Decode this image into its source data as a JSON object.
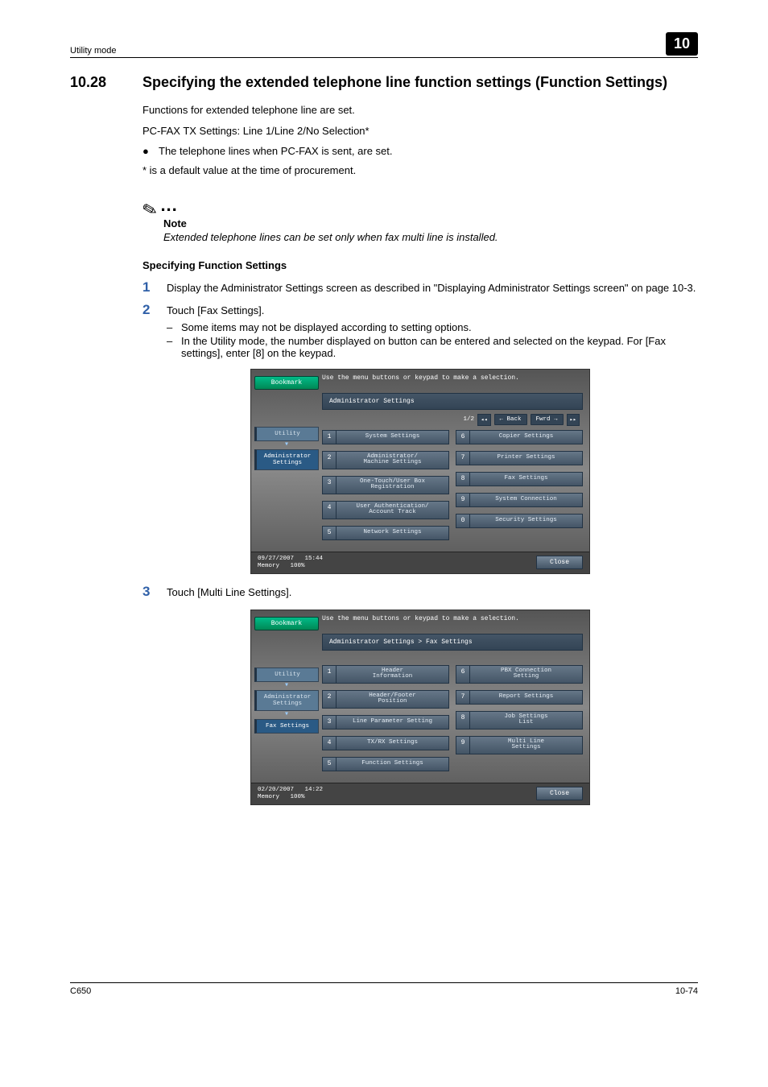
{
  "header": {
    "left": "Utility mode",
    "badge": "10"
  },
  "section": {
    "number": "10.28",
    "title": "Specifying the extended telephone line function settings (Function Settings)"
  },
  "intro": {
    "p1": "Functions for extended telephone line are set.",
    "p2": "PC-FAX TX Settings: Line 1/Line 2/No Selection*",
    "b1": "The telephone lines when PC-FAX is sent, are set.",
    "p3": "* is a default value at the time of procurement."
  },
  "note": {
    "label": "Note",
    "text": "Extended telephone lines can be set only when fax multi line is installed."
  },
  "subhead": "Specifying Function Settings",
  "step1": {
    "text": "Display the Administrator Settings screen as described in \"Displaying Administrator Settings screen\" on page 10-3."
  },
  "step2": {
    "text": "Touch [Fax Settings].",
    "d1": "Some items may not be displayed according to setting options.",
    "d2": "In the Utility mode, the number displayed on button can be entered and selected on the keypad. For [Fax settings], enter [8] on the keypad."
  },
  "step3": {
    "text": "Touch [Multi Line Settings]."
  },
  "ui1": {
    "instr": "Use the menu buttons or keypad to make a selection.",
    "bookmark": "Bookmark",
    "crumbs": [
      "Utility",
      "Administrator\nSettings"
    ],
    "title": "Administrator Settings",
    "page": "1/2",
    "back": "Back",
    "fwd": "Fwrd",
    "left": [
      {
        "n": "1",
        "l": "System Settings"
      },
      {
        "n": "2",
        "l": "Administrator/\nMachine Settings"
      },
      {
        "n": "3",
        "l": "One-Touch/User Box\nRegistration"
      },
      {
        "n": "4",
        "l": "User Authentication/\nAccount Track"
      },
      {
        "n": "5",
        "l": "Network Settings"
      }
    ],
    "right": [
      {
        "n": "6",
        "l": "Copier Settings"
      },
      {
        "n": "7",
        "l": "Printer Settings"
      },
      {
        "n": "8",
        "l": "Fax Settings"
      },
      {
        "n": "9",
        "l": "System Connection"
      },
      {
        "n": "0",
        "l": "Security Settings"
      }
    ],
    "date": "09/27/2007",
    "time": "15:44",
    "mem": "Memory",
    "memv": "100%",
    "close": "Close"
  },
  "ui2": {
    "instr": "Use the menu buttons or keypad to make a selection.",
    "bookmark": "Bookmark",
    "crumbs": [
      "Utility",
      "Administrator\nSettings",
      "Fax Settings"
    ],
    "title": "Administrator Settings  > Fax Settings",
    "left": [
      {
        "n": "1",
        "l": "Header\nInformation"
      },
      {
        "n": "2",
        "l": "Header/Footer\nPosition"
      },
      {
        "n": "3",
        "l": "Line Parameter Setting"
      },
      {
        "n": "4",
        "l": "TX/RX Settings"
      },
      {
        "n": "5",
        "l": "Function Settings"
      }
    ],
    "right": [
      {
        "n": "6",
        "l": "PBX Connection\nSetting"
      },
      {
        "n": "7",
        "l": "Report Settings"
      },
      {
        "n": "8",
        "l": "Job Settings\nList"
      },
      {
        "n": "9",
        "l": "Multi Line\nSettings"
      }
    ],
    "date": "02/20/2007",
    "time": "14:22",
    "mem": "Memory",
    "memv": "100%",
    "close": "Close"
  },
  "footer": {
    "left": "C650",
    "right": "10-74"
  }
}
